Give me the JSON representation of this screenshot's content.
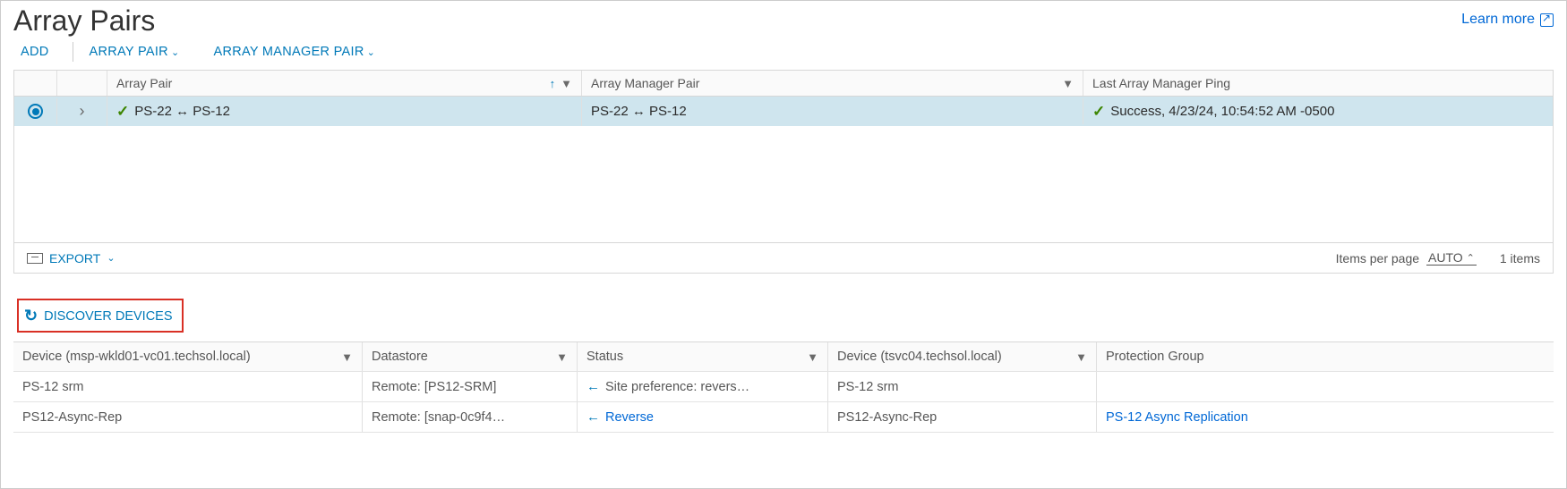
{
  "header": {
    "title": "Array Pairs",
    "learn_more": "Learn more"
  },
  "toolbar": {
    "add": "ADD",
    "array_pair": "ARRAY PAIR",
    "array_manager_pair": "ARRAY MANAGER PAIR"
  },
  "table": {
    "columns": {
      "array_pair": "Array Pair",
      "array_manager_pair": "Array Manager Pair",
      "last_ping": "Last Array Manager Ping"
    },
    "row": {
      "array_pair": "PS-22 ↔ PS-12",
      "array_manager_pair": "PS-22 ↔ PS-12",
      "last_ping": "Success, 4/23/24, 10:54:52 AM -0500"
    },
    "footer": {
      "export": "EXPORT",
      "items_per_page": "Items per page",
      "auto": "AUTO",
      "count": "1 items"
    }
  },
  "discover": {
    "label": "DISCOVER DEVICES"
  },
  "detail": {
    "columns": {
      "device1": "Device (msp-wkld01-vc01.techsol.local)",
      "datastore": "Datastore",
      "status": "Status",
      "device2": "Device (tsvc04.techsol.local)",
      "protection_group": "Protection Group"
    },
    "rows": [
      {
        "device1": "PS-12 srm",
        "datastore": "Remote: [PS12-SRM]",
        "status": "Site preference: revers…",
        "device2": "PS-12 srm",
        "protection_group": ""
      },
      {
        "device1": "PS12-Async-Rep",
        "datastore": "Remote: [snap-0c9f4…",
        "status": "Reverse",
        "device2": "PS12-Async-Rep",
        "protection_group": "PS-12 Async Replication"
      }
    ]
  }
}
